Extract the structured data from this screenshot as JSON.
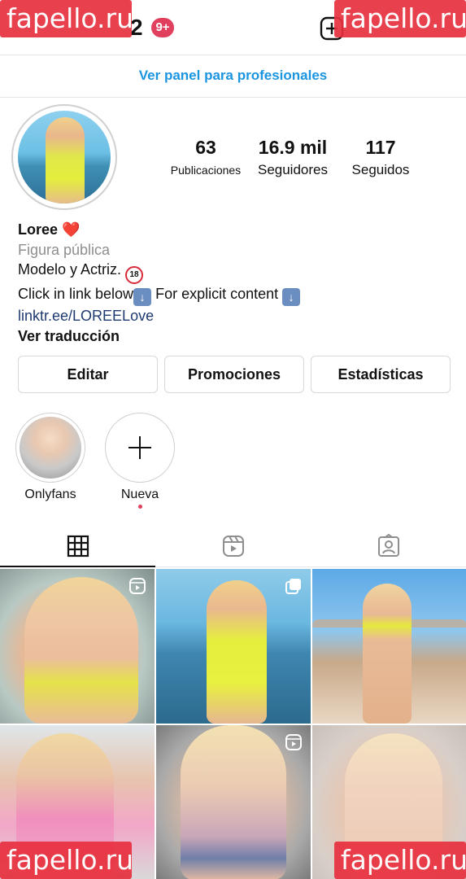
{
  "top_bar": {
    "count_partial": "2",
    "notification_badge": "9+"
  },
  "watermark": "fapello.ru",
  "pro_panel": "Ver panel para profesionales",
  "stats": [
    {
      "value": "63",
      "label": "Publicaciones"
    },
    {
      "value": "16.9 mil",
      "label": "Seguidores"
    },
    {
      "value": "117",
      "label": "Seguidos"
    }
  ],
  "bio": {
    "name": "Loree",
    "name_emoji": "❤️",
    "category": "Figura pública",
    "line1": "Modelo y Actriz.",
    "line1_emoji": "🔞",
    "line2": "Click in link below",
    "line2_emoji": "⬇️",
    "line2_b": "For explicit content",
    "link": "linktr.ee/LOREELove",
    "translate": "Ver traducción"
  },
  "buttons": [
    "Editar",
    "Promociones",
    "Estadísticas"
  ],
  "highlights": [
    {
      "label": "Onlyfans"
    },
    {
      "label": "Nueva"
    }
  ],
  "tabs": [
    "grid-icon",
    "reels-icon",
    "tagged-icon"
  ],
  "colors": {
    "accent_blue": "#1b95e0",
    "link_blue": "#1e3a70",
    "badge_red": "#e0405e",
    "watermark_red": "#e8303f"
  }
}
